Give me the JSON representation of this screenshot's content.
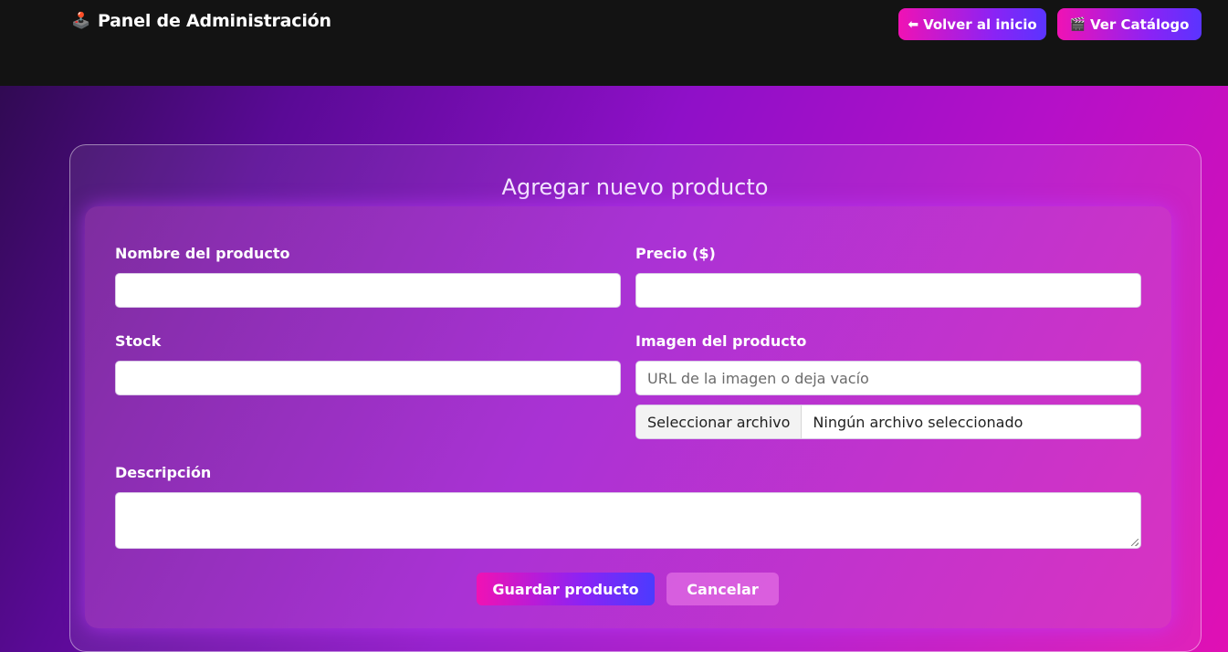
{
  "header": {
    "brand_icon": "🕹️",
    "brand_icon_name": "joystick-icon",
    "title": "Panel de Administración",
    "back_button": {
      "icon": "⬅",
      "icon_name": "arrow-left-icon",
      "label": "Volver al inicio"
    },
    "catalog_button": {
      "icon": "🎬",
      "icon_name": "clapperboard-icon",
      "label": "Ver Catálogo"
    }
  },
  "form": {
    "title": "Agregar nuevo producto",
    "fields": {
      "name": {
        "label": "Nombre del producto",
        "value": ""
      },
      "price": {
        "label": "Precio ($)",
        "value": ""
      },
      "stock": {
        "label": "Stock",
        "value": ""
      },
      "image": {
        "label": "Imagen del producto",
        "url_placeholder": "URL de la imagen o deja vacío",
        "file_button": "Seleccionar archivo",
        "file_status": "Ningún archivo seleccionado"
      },
      "description": {
        "label": "Descripción",
        "value": ""
      }
    },
    "save_label": "Guardar producto",
    "cancel_label": "Cancelar"
  },
  "colors": {
    "topbar": "#131313",
    "accent_pink": "#f012b4",
    "accent_blue": "#5a34ff"
  }
}
